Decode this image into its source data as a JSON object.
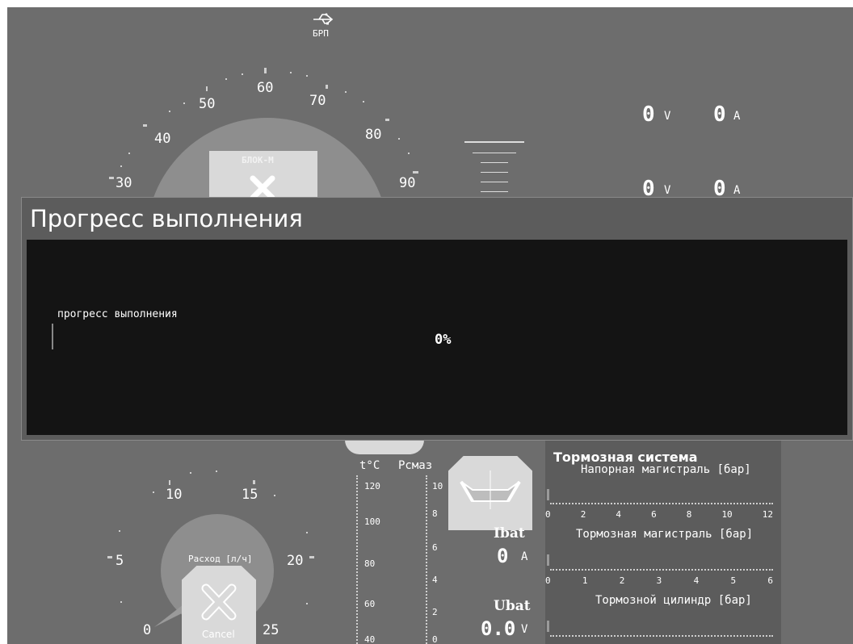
{
  "top_icon": {
    "icon": "usb-icon",
    "label": "БРП"
  },
  "speedometer": {
    "ticks": [
      "30",
      "40",
      "50",
      "60",
      "70",
      "80",
      "90"
    ],
    "block_label": "БЛОК-М"
  },
  "readouts": [
    {
      "value": "0",
      "unit": "V"
    },
    {
      "value": "0",
      "unit": "A"
    },
    {
      "value": "0",
      "unit": "V"
    },
    {
      "value": "0",
      "unit": "A"
    }
  ],
  "modal": {
    "title": "Прогресс выполнения",
    "progress_label": "прогресс выполнения",
    "progress_percent": "0%",
    "progress_value": 0
  },
  "fuel_gauge": {
    "ticks": [
      "0",
      "5",
      "10",
      "15",
      "20",
      "25"
    ],
    "label": "Расход [л/ч]",
    "cancel_label": "Cancel"
  },
  "temp_scale": {
    "label": "t°C",
    "ticks": [
      "120",
      "100",
      "80",
      "60",
      "40"
    ]
  },
  "oil_scale": {
    "label": "Рсмаз",
    "ticks": [
      "10",
      "8",
      "6",
      "4",
      "2",
      "0"
    ]
  },
  "battery": {
    "ibat_label": "Ibat",
    "ibat_value": "0",
    "ibat_unit": "A",
    "vbat_label": "Ubat",
    "vbat_value": "0.0",
    "vbat_unit": "V"
  },
  "brake_system": {
    "title": "Тормозная система",
    "scales": [
      {
        "label": "Напорная магистраль [бар]",
        "ticks": [
          "0",
          "2",
          "4",
          "6",
          "8",
          "10",
          "12"
        ]
      },
      {
        "label": "Тормозная магистраль [бар]",
        "ticks": [
          "0",
          "1",
          "2",
          "3",
          "4",
          "5",
          "6"
        ]
      },
      {
        "label": "Тормозной цилиндр [бар]",
        "ticks": []
      }
    ]
  },
  "colors": {
    "background": "#6d6d6d",
    "modal_body": "#141414",
    "gauge_fill": "#8e8e8e",
    "panel": "#d9d9d9"
  }
}
